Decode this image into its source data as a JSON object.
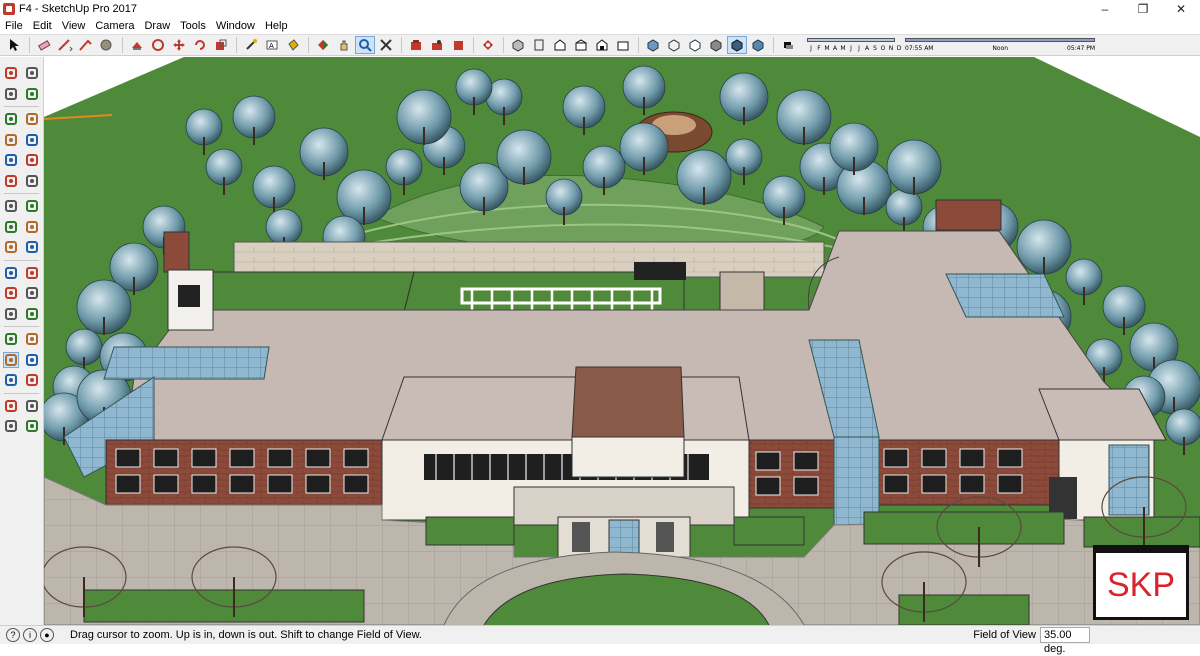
{
  "window": {
    "title": "F4 - SketchUp Pro 2017",
    "controls": [
      "minimize-icon",
      "maximize-icon",
      "close-icon"
    ]
  },
  "menu": [
    "File",
    "Edit",
    "View",
    "Camera",
    "Draw",
    "Tools",
    "Window",
    "Help"
  ],
  "toolbar": {
    "tools": [
      "select-icon",
      "eraser-icon",
      "pencil-icon",
      "eraser-2-icon",
      "paint-icon",
      "orbit-icon",
      "rotate-icon",
      "move-icon",
      "rotate-2-icon",
      "scale-icon",
      "tape-icon",
      "text-icon",
      "paint-bucket-icon",
      "push-pull-icon",
      "pan-icon",
      "zoom-icon",
      "zoom-extents-icon",
      "warehouse-icon",
      "components-icon",
      "styles-icon",
      "sandbox-icon",
      "iso-view-icon",
      "top-view-icon",
      "front-view-icon",
      "right-view-icon",
      "back-view-icon",
      "left-view-icon",
      "xray-icon",
      "wireframe-icon",
      "hidden-line-icon",
      "shaded-icon",
      "textured-icon",
      "monochrome-icon",
      "shadows-icon"
    ],
    "shadow_months": [
      "J",
      "F",
      "M",
      "A",
      "M",
      "J",
      "J",
      "A",
      "S",
      "O",
      "N",
      "D"
    ],
    "shadow_times": [
      "07:55 AM",
      "Noon",
      "05:47 PM"
    ]
  },
  "left_tools": [
    [
      "select-icon",
      "component-icon"
    ],
    [
      "paint-icon",
      "eraser-icon"
    ],
    [
      "line-icon",
      "freehand-icon"
    ],
    [
      "rectangle-icon",
      "rotated-rectangle-icon"
    ],
    [
      "circle-icon",
      "polygon-icon"
    ],
    [
      "arc-icon",
      "pie-icon"
    ],
    [
      "move-icon",
      "push-pull-icon"
    ],
    [
      "rotate-icon",
      "follow-me-icon"
    ],
    [
      "scale-icon",
      "offset-icon"
    ],
    [
      "tape-measure-icon",
      "dimension-icon"
    ],
    [
      "protractor-icon",
      "text-icon"
    ],
    [
      "axes-icon",
      "3d-text-icon"
    ],
    [
      "orbit-icon",
      "pan-icon"
    ],
    [
      "zoom-icon",
      "zoom-window-icon"
    ],
    [
      "zoom-extents-icon",
      "previous-view-icon"
    ],
    [
      "position-camera-icon",
      "look-around-icon"
    ],
    [
      "walk-icon",
      "section-plane-icon"
    ]
  ],
  "badge": {
    "text": "SKP",
    "color": "#d9232d"
  },
  "status": {
    "message": "Drag cursor to zoom.  Up is in, down is out. Shift to change Field of View.",
    "fov_label": "Field of View",
    "fov_value": "35.00 deg."
  },
  "colors": {
    "grass": "#4f8a3b",
    "roof": "#c6b8b2",
    "brick": "#8b4a3a",
    "glass": "#8fb7cf",
    "paving": "#bdb6ad"
  }
}
